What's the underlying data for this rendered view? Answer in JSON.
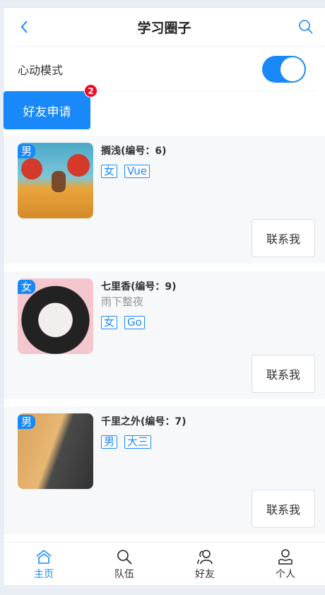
{
  "header": {
    "title": "学习圈子",
    "back_icon": "chevron-left-icon",
    "search_icon": "search-icon"
  },
  "heart_mode": {
    "label": "心动模式",
    "enabled": true
  },
  "friend_request": {
    "label": "好友申请",
    "badge": "2"
  },
  "colors": {
    "accent": "#1989fa",
    "badge": "#ee0a24",
    "card_bg": "#f7f8fa"
  },
  "users": [
    {
      "gender": "男",
      "name": "搁浅(编号：6)",
      "profile": "",
      "tags": [
        "女",
        "Vue"
      ],
      "contact": "联系我"
    },
    {
      "gender": "女",
      "name": "七里香(编号：9)",
      "profile": "雨下整夜",
      "tags": [
        "女",
        "Go"
      ],
      "contact": "联系我"
    },
    {
      "gender": "男",
      "name": "千里之外(编号：7)",
      "profile": "",
      "tags": [
        "男",
        "大三"
      ],
      "contact": "联系我"
    }
  ],
  "tabbar": [
    {
      "label": "主页",
      "icon": "home-icon",
      "active": true
    },
    {
      "label": "队伍",
      "icon": "search-icon"
    },
    {
      "label": "好友",
      "icon": "friends-icon"
    },
    {
      "label": "个人",
      "icon": "user-icon"
    }
  ]
}
